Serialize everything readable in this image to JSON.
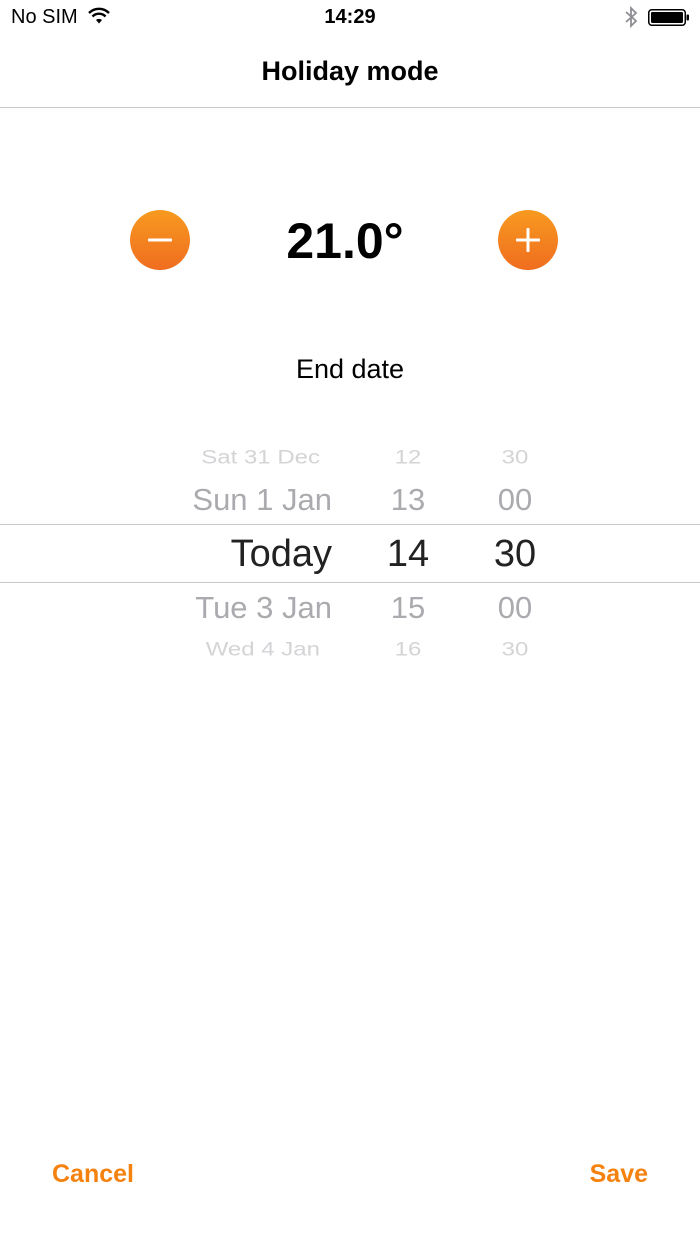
{
  "status_bar": {
    "carrier": "No SIM",
    "time": "14:29",
    "icons": [
      "wifi-icon",
      "bluetooth-icon",
      "battery-icon"
    ]
  },
  "nav": {
    "title": "Holiday mode"
  },
  "temperature": {
    "value": "21.0°",
    "decrease_icon": "minus-icon",
    "increase_icon": "plus-icon"
  },
  "end_date": {
    "label": "End date",
    "picker": {
      "dates": [
        "Sat 31 Dec",
        "Sun 1 Jan",
        "Today",
        "Tue 3 Jan",
        "Wed 4 Jan"
      ],
      "hours": [
        "12",
        "13",
        "14",
        "15",
        "16"
      ],
      "minutes": [
        "30",
        "00",
        "30",
        "00",
        "30"
      ],
      "selected": {
        "date": "Today",
        "hour": "14",
        "minute": "30"
      }
    }
  },
  "actions": {
    "cancel": "Cancel",
    "save": "Save"
  },
  "colors": {
    "accent": "#f5820f",
    "button_gradient_top": "#f89a20",
    "button_gradient_bottom": "#ef6d1f",
    "separator": "#c8c7cc"
  }
}
